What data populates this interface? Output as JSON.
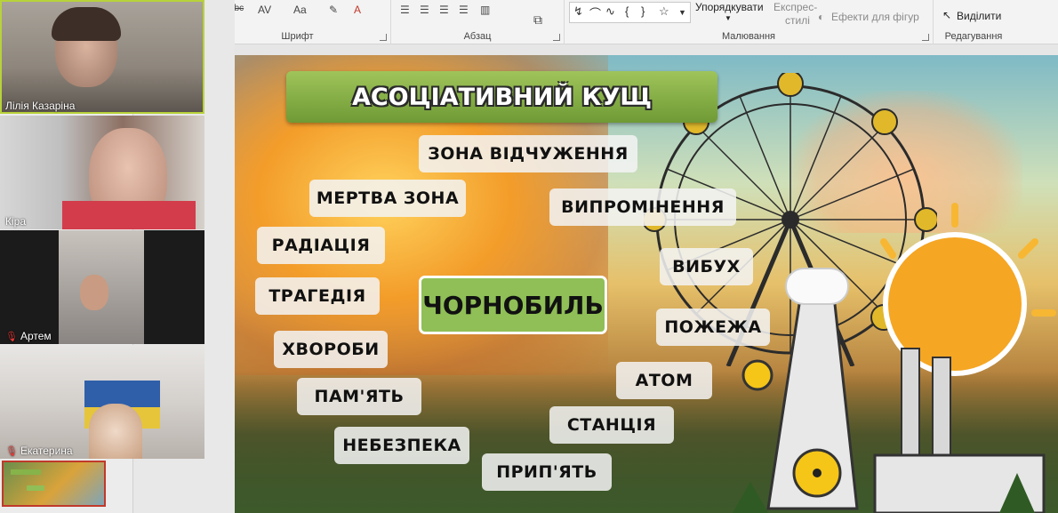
{
  "ribbon": {
    "groups": [
      {
        "label": "Шрифт"
      },
      {
        "label": "Абзац"
      },
      {
        "label": "Малювання"
      },
      {
        "label": "Редагування"
      }
    ],
    "font_icons": [
      "S",
      "abc",
      "AV",
      "Aa"
    ],
    "arrange_label": "Упорядкувати",
    "quick_styles_label_1": "Експрес-",
    "quick_styles_label_2": "стилі",
    "shape_effects_label": "Ефекти для фігур",
    "select_label": "Виділити"
  },
  "participants": [
    {
      "name": "Лілія Казаріна",
      "muted": false,
      "speaking": true
    },
    {
      "name": "Кіра",
      "muted": false,
      "speaking": false
    },
    {
      "name": "Артем",
      "muted": true,
      "speaking": false
    },
    {
      "name": "Екатерина",
      "muted": true,
      "speaking": false
    }
  ],
  "slide": {
    "title": "АСОЦІАТИВНИЙ КУЩ",
    "center_word": "ЧОРНОБИЛЬ",
    "words": [
      "ЗОНА ВІДЧУЖЕННЯ",
      "МЕРТВА ЗОНА",
      "ВИПРОМІНЕННЯ",
      "РАДІАЦІЯ",
      "ВИБУХ",
      "ТРАГЕДІЯ",
      "ПОЖЕЖА",
      "ХВОРОБИ",
      "АТОМ",
      "ПАМ'ЯТЬ",
      "СТАНЦІЯ",
      "НЕБЕЗПЕКА",
      "ПРИП'ЯТЬ"
    ]
  },
  "colors": {
    "title_green": "#7fa83f",
    "center_green": "#8fbf56",
    "word_bg": "#f3f3f3",
    "speaking_border": "#b8d23a",
    "muted_mic": "#e53935"
  }
}
